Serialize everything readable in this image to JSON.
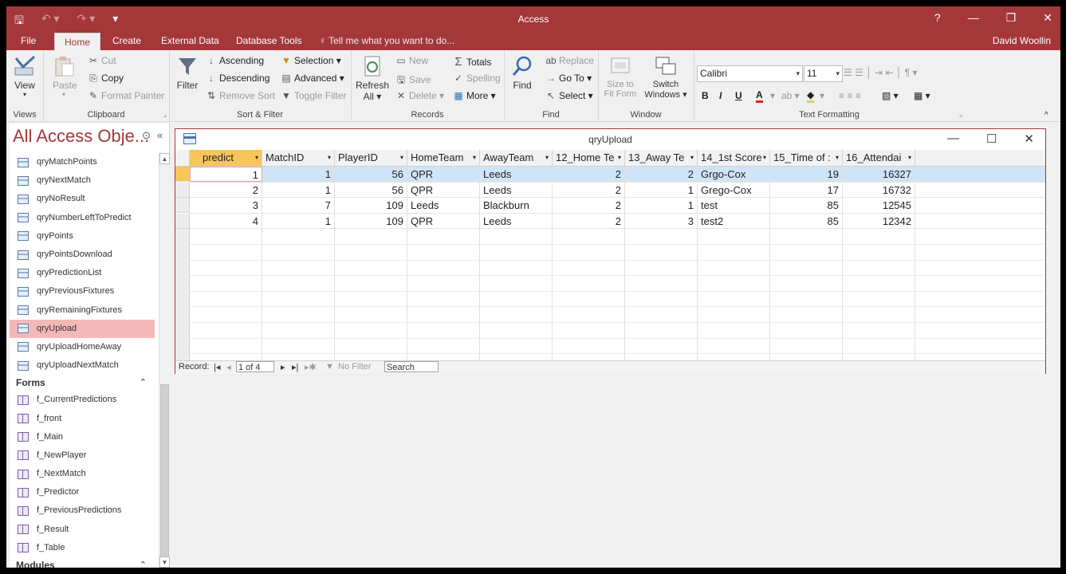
{
  "window": {
    "app_title": "Access",
    "help": "?",
    "minimize": "—",
    "restore": "❐",
    "close": "✕"
  },
  "qat": {
    "save": "🖫",
    "undo": "↶ ▾",
    "redo": "↷ ▾",
    "customize": "▾"
  },
  "tabs": [
    "File",
    "Home",
    "Create",
    "External Data",
    "Database Tools"
  ],
  "tell_me": "Tell me what you want to do...",
  "user": "David Woollin",
  "ribbon": {
    "views": {
      "label": "Views",
      "view": "View"
    },
    "clipboard": {
      "label": "Clipboard",
      "paste": "Paste",
      "cut": "Cut",
      "copy": "Copy",
      "format_painter": "Format Painter"
    },
    "sort_filter": {
      "label": "Sort & Filter",
      "filter": "Filter",
      "ascending": "Ascending",
      "descending": "Descending",
      "remove_sort": "Remove Sort",
      "selection": "Selection ▾",
      "advanced": "Advanced ▾",
      "toggle_filter": "Toggle Filter"
    },
    "records": {
      "label": "Records",
      "refresh": "Refresh",
      "refresh_all": "All ▾",
      "new": "New",
      "save": "Save",
      "delete": "Delete",
      "totals": "Totals",
      "spelling": "Spelling",
      "more": "More ▾"
    },
    "find": {
      "label": "Find",
      "find": "Find",
      "replace": "Replace",
      "goto": "Go To ▾",
      "select": "Select ▾"
    },
    "window": {
      "label": "Window",
      "size_to": "Size to",
      "fit_form": "Fit Form",
      "switch": "Switch",
      "windows": "Windows ▾"
    },
    "text_formatting": {
      "label": "Text Formatting",
      "font": "Calibri",
      "size": "11",
      "bold": "B",
      "italic": "I",
      "underline": "U",
      "font_color": "A"
    }
  },
  "nav": {
    "title": "All Access Obje...",
    "queries": [
      "qryMatchPoints",
      "qryNextMatch",
      "qryNoResult",
      "qryNumberLeftToPredict",
      "qryPoints",
      "qryPointsDownload",
      "qryPredictionList",
      "qryPreviousFixtures",
      "qryRemainingFixtures",
      "qryUpload",
      "qryUploadHomeAway",
      "qryUploadNextMatch"
    ],
    "selected": "qryUpload",
    "forms_label": "Forms",
    "forms": [
      "f_CurrentPredictions",
      "f_front",
      "f_Main",
      "f_NewPlayer",
      "f_NextMatch",
      "f_Predictor",
      "f_PreviousPredictions",
      "f_Result",
      "f_Table"
    ],
    "modules_label": "Modules"
  },
  "doc": {
    "title": "qryUpload",
    "columns": [
      "predict",
      "MatchID",
      "PlayerID",
      "HomeTeam",
      "AwayTeam",
      "12_Home Te",
      "13_Away Te",
      "14_1st Score",
      "15_Time of :",
      "16_Attendai"
    ],
    "rows": [
      [
        "1",
        "1",
        "56",
        "QPR",
        "Leeds",
        "2",
        "2",
        "Grgo-Cox",
        "19",
        "16327"
      ],
      [
        "2",
        "1",
        "56",
        "QPR",
        "Leeds",
        "2",
        "1",
        "Grego-Cox",
        "17",
        "16732"
      ],
      [
        "3",
        "7",
        "109",
        "Leeds",
        "Blackburn",
        "2",
        "1",
        "test",
        "85",
        "12545"
      ],
      [
        "4",
        "1",
        "109",
        "QPR",
        "Leeds",
        "2",
        "3",
        "test2",
        "85",
        "12342"
      ]
    ],
    "record_label": "Record:",
    "record_pos": "1 of 4",
    "no_filter": "No Filter",
    "search": "Search"
  }
}
